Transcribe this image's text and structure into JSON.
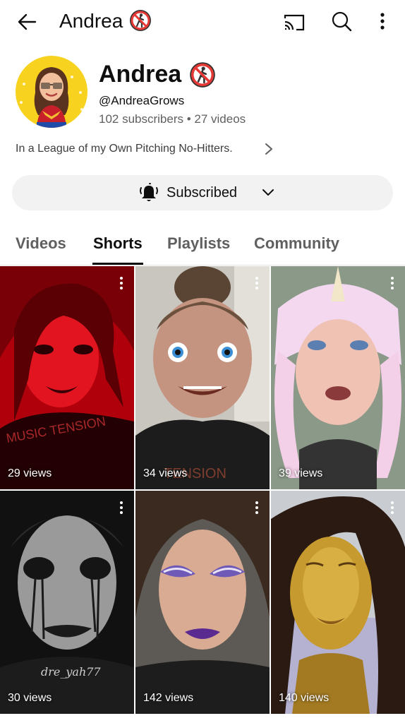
{
  "topbar": {
    "title": "Andrea",
    "badge_icon": "not-allowed-person-icon",
    "cast_icon": "cast-icon",
    "search_icon": "search-icon",
    "more_icon": "more-vertical-icon"
  },
  "channel": {
    "name": "Andrea",
    "handle": "@AndreaGrows",
    "stats": "102 subscribers • 27 videos",
    "description": "In a League of my Own Pitching No-Hitters.",
    "avatar_icon": "superhero-avatar-icon"
  },
  "subscribe": {
    "label": "Subscribed",
    "icon": "bell-ringing-icon"
  },
  "tabs": [
    {
      "label": "Videos"
    },
    {
      "label": "Shorts"
    },
    {
      "label": "Playlists"
    },
    {
      "label": "Community"
    }
  ],
  "active_tab": "Shorts",
  "shorts": [
    {
      "views": "29 views"
    },
    {
      "views": "34 views"
    },
    {
      "views": "39 views"
    },
    {
      "views": "30 views",
      "overlay_text": "dre_yah77"
    },
    {
      "views": "142 views"
    },
    {
      "views": "140 views"
    }
  ],
  "colors": {
    "accent": "#0f0f0f",
    "secondary_text": "#606060",
    "button_bg": "#f2f2f2"
  }
}
